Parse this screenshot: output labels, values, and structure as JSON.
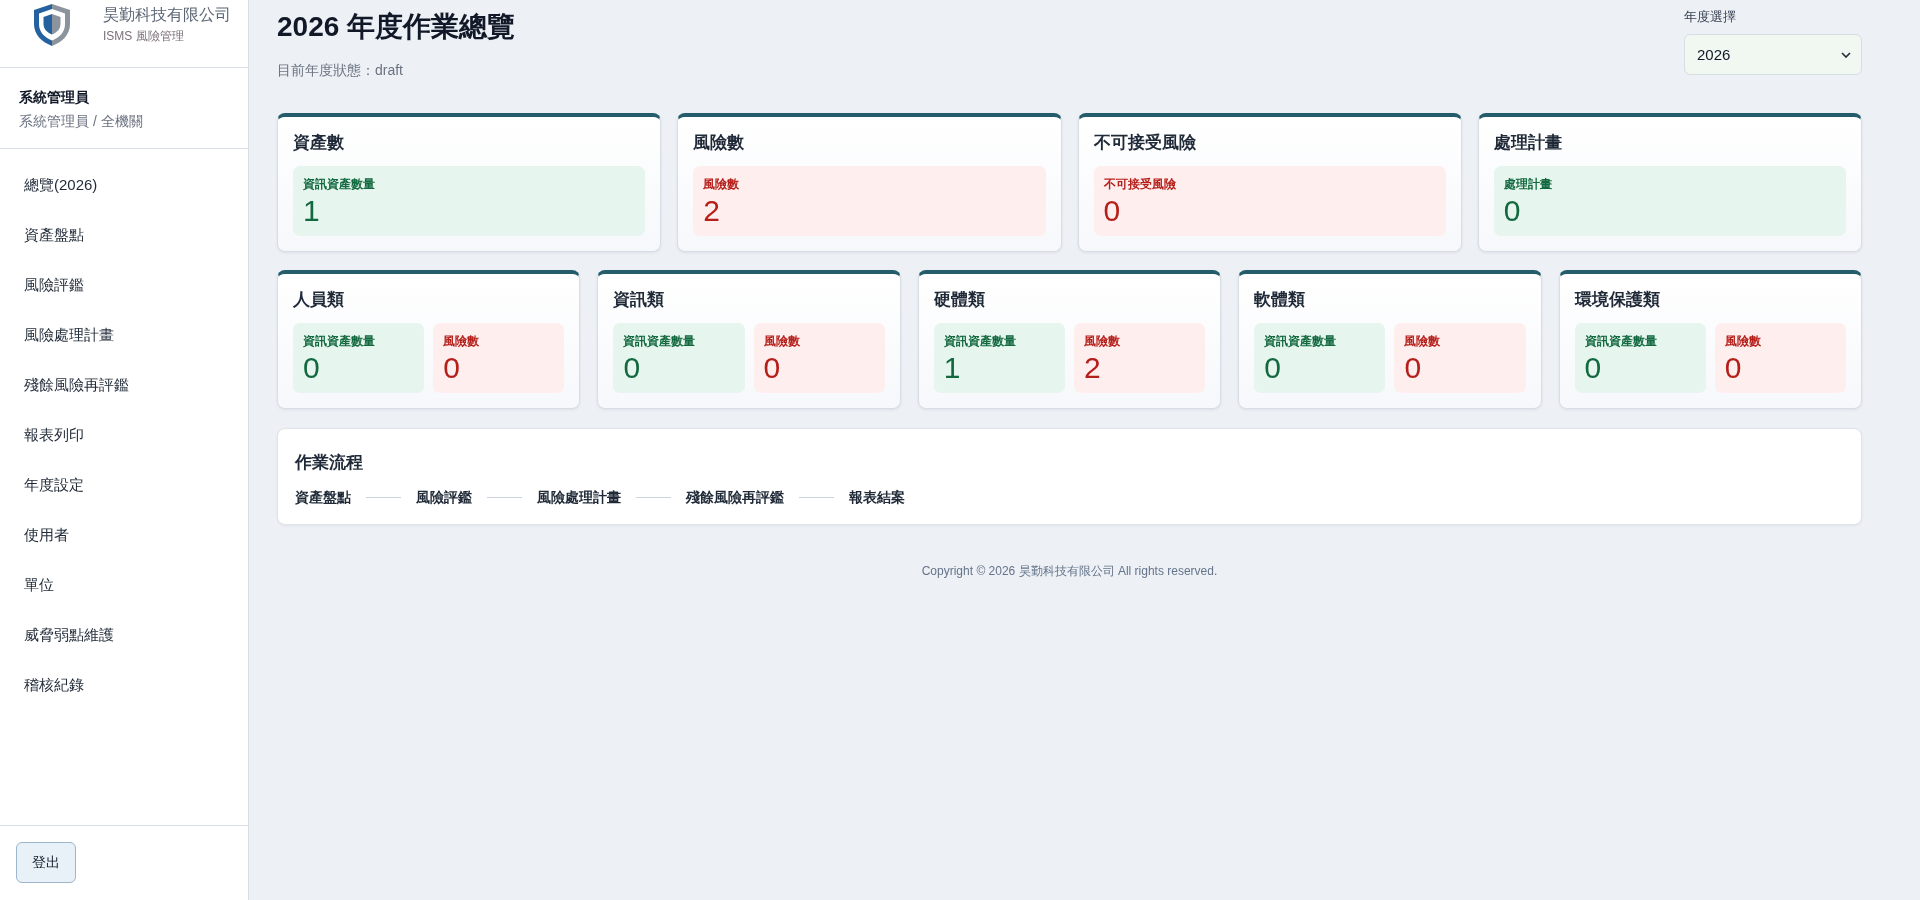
{
  "sidebar": {
    "brand": {
      "name": "昊勤科技有限公司",
      "subtitle": "ISMS 風險管理"
    },
    "user": {
      "name": "系統管理員",
      "role": "系統管理員 / 全機關"
    },
    "nav": [
      "總覽(2026)",
      "資產盤點",
      "風險評鑑",
      "風險處理計畫",
      "殘餘風險再評鑑",
      "報表列印",
      "年度設定",
      "使用者",
      "單位",
      "威脅弱點維護",
      "稽核紀錄"
    ],
    "logout": "登出"
  },
  "header": {
    "title": "2026 年度作業總覽",
    "status": "目前年度狀態：draft",
    "year_select": {
      "label": "年度選擇",
      "value": "2026"
    }
  },
  "summary_cards": [
    {
      "title": "資產數",
      "stats": [
        {
          "kind": "ok",
          "label": "資訊資產數量",
          "value": "1"
        }
      ]
    },
    {
      "title": "風險數",
      "stats": [
        {
          "kind": "warn",
          "label": "風險數",
          "value": "2"
        }
      ]
    },
    {
      "title": "不可接受風險",
      "stats": [
        {
          "kind": "warn",
          "label": "不可接受風險",
          "value": "0"
        }
      ]
    },
    {
      "title": "處理計畫",
      "stats": [
        {
          "kind": "ok",
          "label": "處理計畫",
          "value": "0"
        }
      ]
    }
  ],
  "category_cards": [
    {
      "title": "人員類",
      "stats": [
        {
          "kind": "ok",
          "label": "資訊資產數量",
          "value": "0"
        },
        {
          "kind": "warn",
          "label": "風險數",
          "value": "0"
        }
      ]
    },
    {
      "title": "資訊類",
      "stats": [
        {
          "kind": "ok",
          "label": "資訊資產數量",
          "value": "0"
        },
        {
          "kind": "warn",
          "label": "風險數",
          "value": "0"
        }
      ]
    },
    {
      "title": "硬體類",
      "stats": [
        {
          "kind": "ok",
          "label": "資訊資產數量",
          "value": "1"
        },
        {
          "kind": "warn",
          "label": "風險數",
          "value": "2"
        }
      ]
    },
    {
      "title": "軟體類",
      "stats": [
        {
          "kind": "ok",
          "label": "資訊資產數量",
          "value": "0"
        },
        {
          "kind": "warn",
          "label": "風險數",
          "value": "0"
        }
      ]
    },
    {
      "title": "環境保護類",
      "stats": [
        {
          "kind": "ok",
          "label": "資訊資產數量",
          "value": "0"
        },
        {
          "kind": "warn",
          "label": "風險數",
          "value": "0"
        }
      ]
    }
  ],
  "workflow": {
    "title": "作業流程",
    "steps": [
      "資產盤點",
      "風險評鑑",
      "風險處理計畫",
      "殘餘風險再評鑑",
      "報表結案"
    ]
  },
  "footer": "Copyright © 2026 昊勤科技有限公司 All rights reserved."
}
